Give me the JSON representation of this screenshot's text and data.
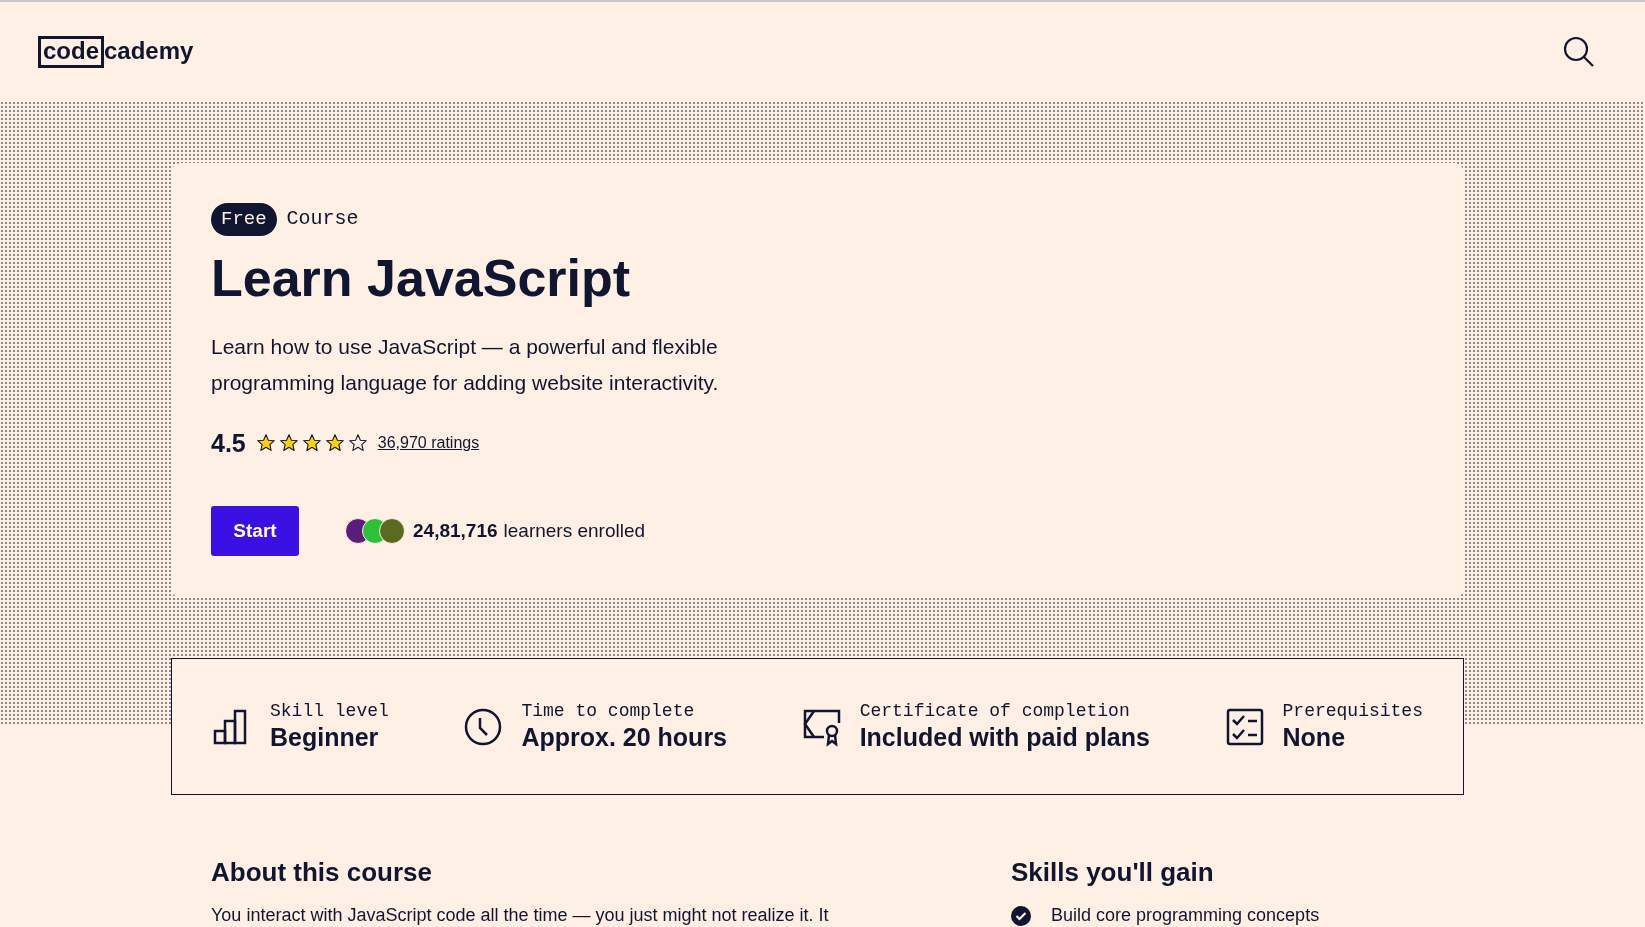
{
  "header": {
    "logo_boxed": "code",
    "logo_rest": "cademy"
  },
  "course": {
    "badge": "Free",
    "type": "Course",
    "title": "Learn JavaScript",
    "description": "Learn how to use JavaScript — a powerful and flexible programming language for adding website interactivity.",
    "rating": "4.5",
    "stars": 4,
    "ratings_link": "36,970 ratings",
    "start_button": "Start",
    "learners_count": "24,81,716",
    "learners_text": "learners enrolled"
  },
  "stats": [
    {
      "kind": "skill",
      "label": "Skill level",
      "value": "Beginner"
    },
    {
      "kind": "time",
      "label": "Time to complete",
      "value": "Approx. 20 hours"
    },
    {
      "kind": "certificate",
      "label": "Certificate of completion",
      "value": "Included with paid plans"
    },
    {
      "kind": "prereq",
      "label": "Prerequisites",
      "value": "None"
    }
  ],
  "about": {
    "heading": "About this course",
    "text": "You interact with JavaScript code all the time — you just might not realize it. It"
  },
  "skills": {
    "heading": "Skills you'll gain",
    "items": [
      "Build core programming concepts"
    ]
  }
}
